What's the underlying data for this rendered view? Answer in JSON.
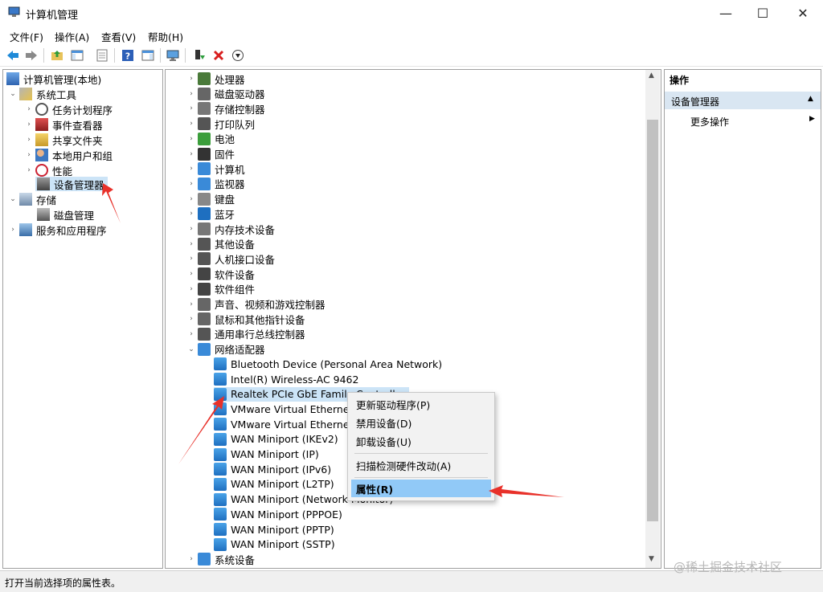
{
  "window": {
    "title": "计算机管理",
    "minimize": "—",
    "maximize": "☐",
    "close": "✕"
  },
  "menu": [
    "文件(F)",
    "操作(A)",
    "查看(V)",
    "帮助(H)"
  ],
  "left_tree": {
    "root": "计算机管理(本地)",
    "system_tools": "系统工具",
    "task_scheduler": "任务计划程序",
    "event_viewer": "事件查看器",
    "shared_folders": "共享文件夹",
    "local_users": "本地用户和组",
    "performance": "性能",
    "device_manager": "设备管理器",
    "storage": "存储",
    "disk_management": "磁盘管理",
    "services": "服务和应用程序"
  },
  "devices": [
    "处理器",
    "磁盘驱动器",
    "存储控制器",
    "打印队列",
    "电池",
    "固件",
    "计算机",
    "监视器",
    "键盘",
    "蓝牙",
    "内存技术设备",
    "其他设备",
    "人机接口设备",
    "软件设备",
    "软件组件",
    "声音、视频和游戏控制器",
    "鼠标和其他指针设备",
    "通用串行总线控制器",
    "网络适配器"
  ],
  "network_adapters": [
    "Bluetooth Device (Personal Area Network)",
    "Intel(R) Wireless-AC 9462",
    "Realtek PCIe GbE Family Controller",
    "VMware Virtual Ethernet Adapter for VMnet1",
    "VMware Virtual Ethernet Adapter for VMnet8",
    "WAN Miniport (IKEv2)",
    "WAN Miniport (IP)",
    "WAN Miniport (IPv6)",
    "WAN Miniport (L2TP)",
    "WAN Miniport (Network Monitor)",
    "WAN Miniport (PPPOE)",
    "WAN Miniport (PPTP)",
    "WAN Miniport (SSTP)"
  ],
  "after_network": "系统设备",
  "actions": {
    "title": "操作",
    "section": "设备管理器",
    "more": "更多操作"
  },
  "context_menu": {
    "update_driver": "更新驱动程序(P)",
    "disable": "禁用设备(D)",
    "uninstall": "卸载设备(U)",
    "scan": "扫描检测硬件改动(A)",
    "properties": "属性(R)"
  },
  "status": "打开当前选择项的属性表。",
  "watermark": "@稀土掘金技术社区",
  "colors": {
    "selection": "#cce4f7",
    "highlight": "#91c9f7",
    "arrow": "#e8312a"
  }
}
